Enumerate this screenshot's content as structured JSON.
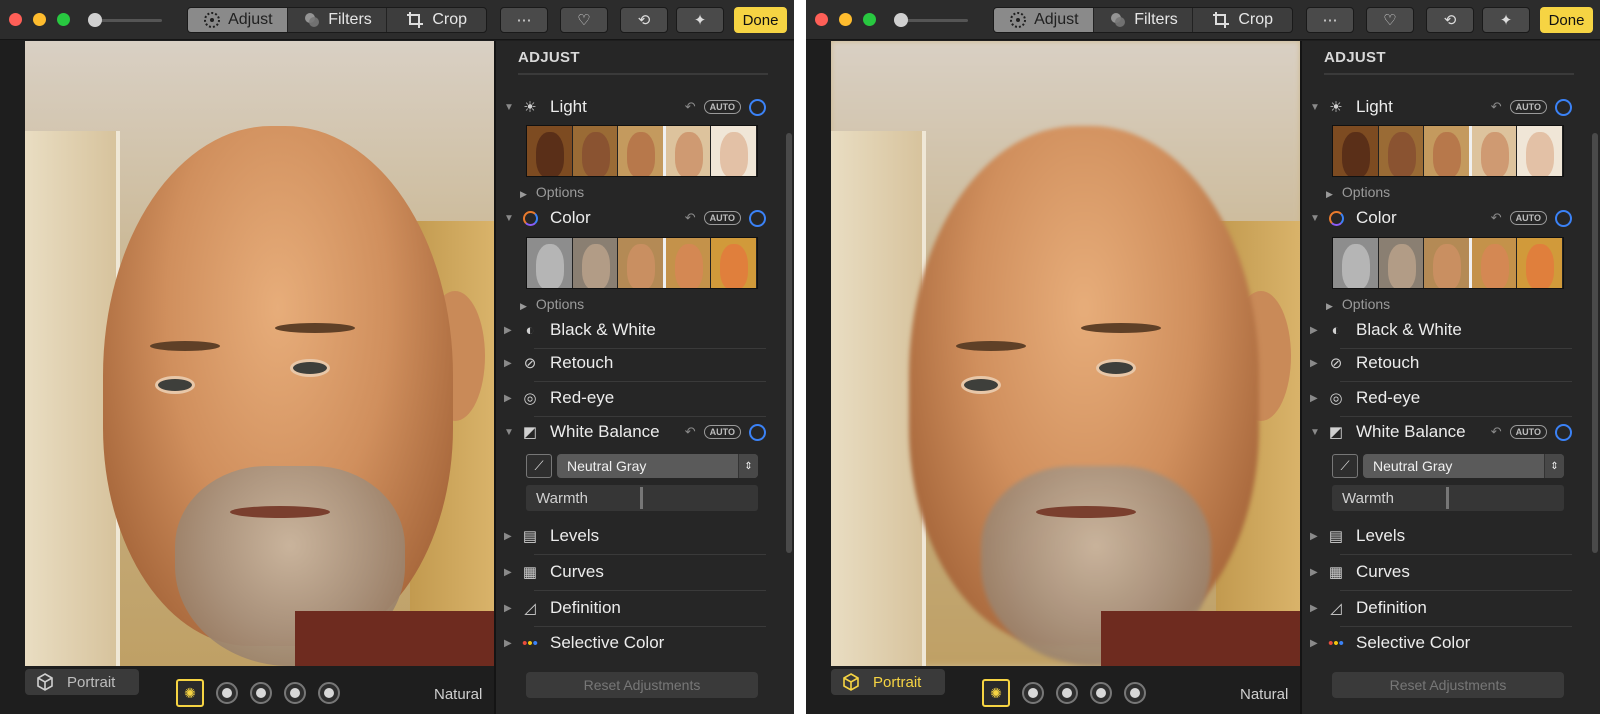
{
  "toolbar": {
    "tabs": [
      {
        "label": "Adjust",
        "icon": "adjust-dial-icon",
        "active": true
      },
      {
        "label": "Filters",
        "icon": "filters-circles-icon",
        "active": false
      },
      {
        "label": "Crop",
        "icon": "crop-icon",
        "active": false
      }
    ],
    "tools": [
      "more-icon",
      "heart-icon",
      "rotate-icon",
      "magic-wand-icon"
    ],
    "done_label": "Done"
  },
  "panel": {
    "title": "ADJUST",
    "options_label": "Options",
    "auto_label": "AUTO",
    "sections": {
      "light": "Light",
      "color": "Color",
      "black_white": "Black & White",
      "retouch": "Retouch",
      "red_eye": "Red-eye",
      "white_balance": "White Balance",
      "levels": "Levels",
      "curves": "Curves",
      "definition": "Definition",
      "selective_color": "Selective Color"
    },
    "white_balance": {
      "preset": "Neutral Gray",
      "slider_label": "Warmth"
    },
    "reset_label": "Reset Adjustments"
  },
  "bottom": {
    "portrait_label": "Portrait",
    "lighting_label": "Natural"
  },
  "screens": [
    {
      "id": "left",
      "portrait_enabled": false
    },
    {
      "id": "right",
      "portrait_enabled": true
    }
  ],
  "colors": {
    "accent_yellow": "#f6d443",
    "ring_blue": "#3b82f6",
    "panel_bg": "#262626"
  }
}
